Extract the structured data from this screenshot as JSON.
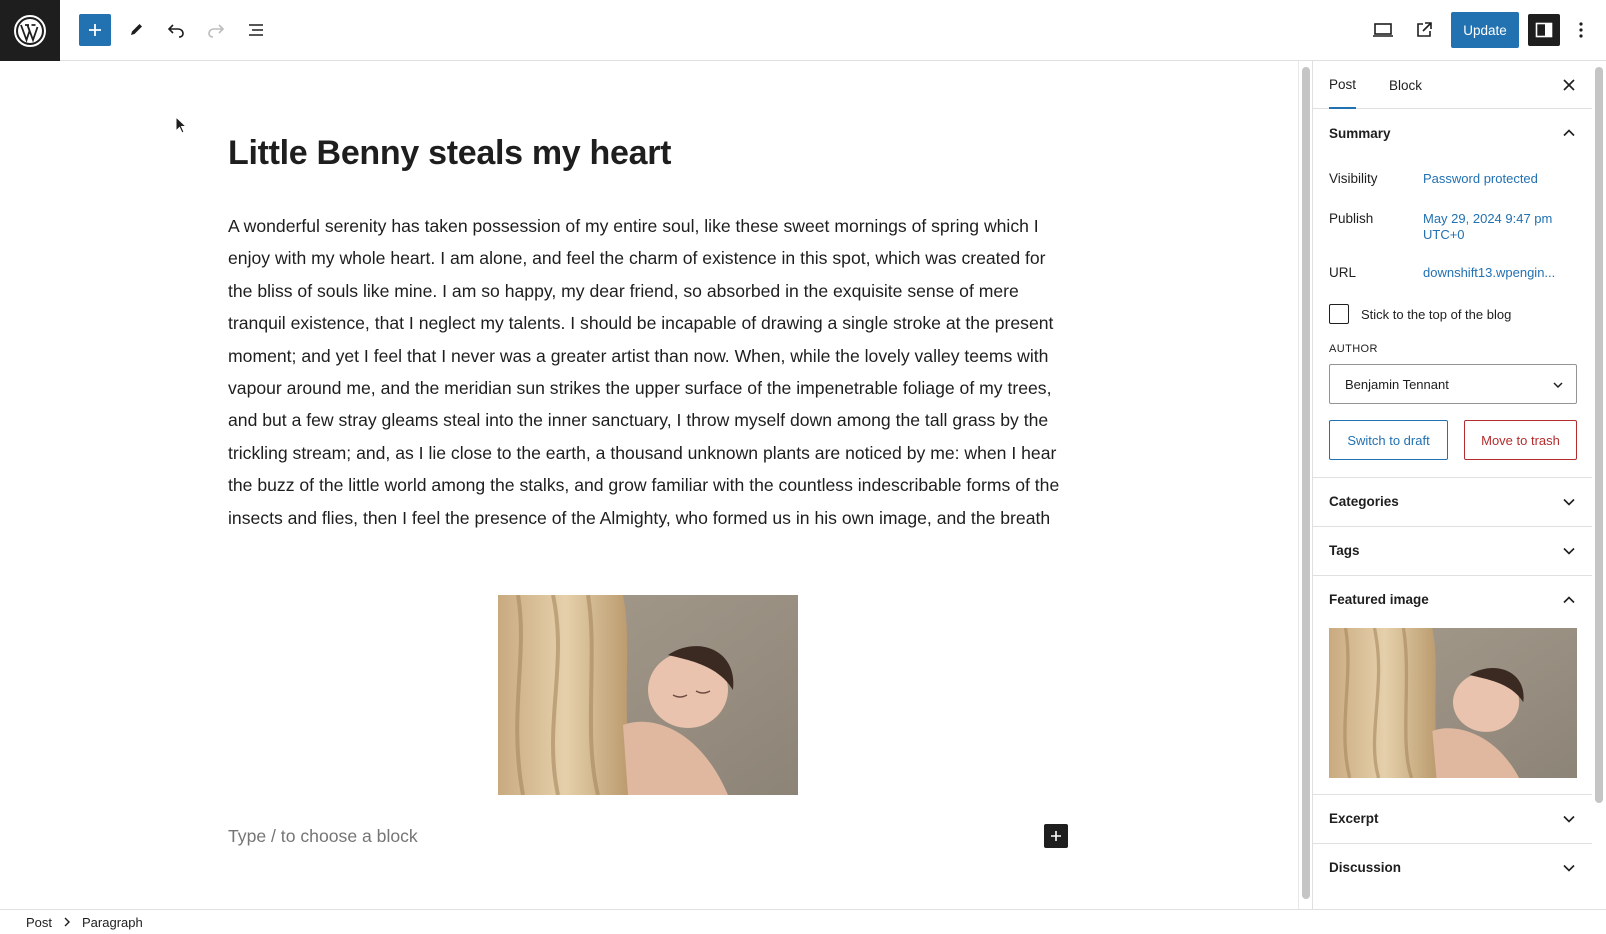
{
  "topbar": {
    "logo": "wordpress-logo",
    "update_label": "Update",
    "icons": [
      "plus-icon",
      "pencil-icon",
      "undo-icon",
      "redo-icon",
      "list-view-icon",
      "desktop-preview-icon",
      "external-link-icon",
      "sidebar-toggle-icon",
      "more-vertical-icon"
    ]
  },
  "post": {
    "title": "Little Benny steals my heart",
    "body": "A wonderful serenity has taken possession of my entire soul, like these sweet mornings of spring which I enjoy with my whole heart. I am alone, and feel the charm of existence in this spot, which was created for the bliss of souls like mine. I am so happy, my dear friend, so absorbed in the exquisite sense of mere tranquil existence, that I neglect my talents. I should be incapable of drawing a single stroke at the present moment; and yet I feel that I never was a greater artist than now. When, while the lovely valley teems with vapour around me, and the meridian sun strikes the upper surface of the impenetrable foliage of my trees, and but a few stray gleams steal into the inner sanctuary, I throw myself down among the tall grass by the trickling stream; and, as I lie close to the earth, a thousand unknown plants are noticed by me: when I hear the buzz of the little world among the stalks, and grow familiar with the countless indescribable forms of the insects and flies, then I feel the presence of the Almighty, who formed us in his own image, and the breath",
    "placeholder": "Type / to choose a block"
  },
  "sidebar": {
    "tabs": [
      {
        "label": "Post",
        "active": true
      },
      {
        "label": "Block",
        "active": false
      }
    ],
    "summary": {
      "title": "Summary",
      "visibility_label": "Visibility",
      "visibility_value": "Password protected",
      "publish_label": "Publish",
      "publish_value_line1": "May 29, 2024 9:47 pm",
      "publish_value_line2": "UTC+0",
      "url_label": "URL",
      "url_value": "downshift13.wpengin...",
      "sticky_label": "Stick to the top of the blog",
      "author_label": "AUTHOR",
      "author_value": "Benjamin Tennant",
      "switch_draft_label": "Switch to draft",
      "trash_label": "Move to trash"
    },
    "panels": {
      "categories": "Categories",
      "tags": "Tags",
      "featured_image": "Featured image",
      "excerpt": "Excerpt",
      "discussion": "Discussion"
    }
  },
  "footer": {
    "crumbs": [
      "Post",
      "Paragraph"
    ]
  },
  "colors": {
    "accent": "#2271b1",
    "dark": "#1e1e1e",
    "danger": "#b32d2e"
  }
}
